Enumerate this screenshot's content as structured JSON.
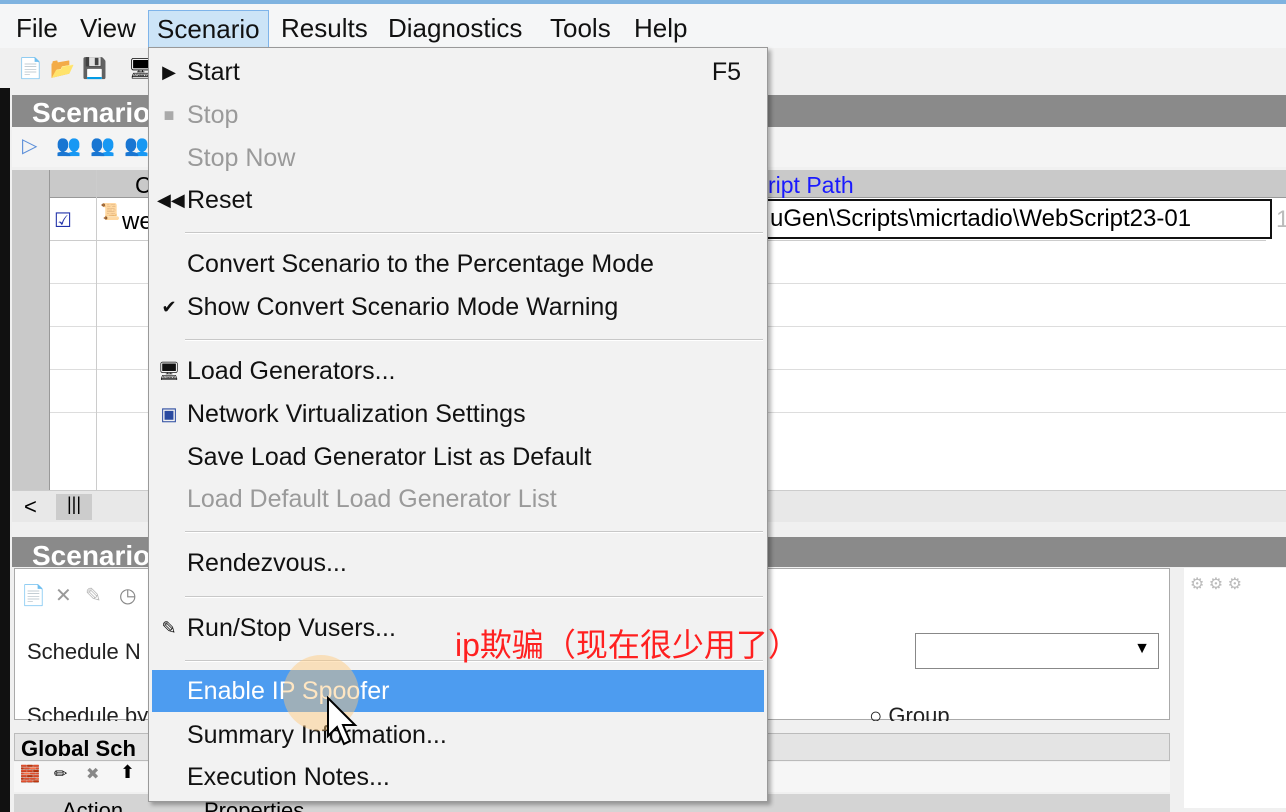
{
  "menubar": {
    "items": [
      "File",
      "View",
      "Scenario",
      "Results",
      "Diagnostics",
      "Tools",
      "Help"
    ],
    "active": "Scenario"
  },
  "scenario_groups": {
    "title": "Scenario",
    "grid": {
      "header_partial": "C",
      "script_path_header": "ript Path",
      "row": {
        "checked": true,
        "name_partial": "we",
        "script_path": "uGen\\Scripts\\micrtadio\\WebScript23-01",
        "next_partial": "1"
      }
    }
  },
  "scenario_schedule": {
    "title": "Scenario",
    "schedule_name_label": "Schedule N",
    "schedule_by_label": "Schedule by",
    "group_option": "Group",
    "global_schedule_title": "Global Sch",
    "action_header": "Action",
    "properties_header": "Properties"
  },
  "scenario_menu": {
    "items": [
      {
        "label": "Start",
        "shortcut": "F5",
        "icon": "play-icon",
        "disabled": false
      },
      {
        "label": "Stop",
        "icon": "stop-icon",
        "disabled": true
      },
      {
        "label": "Stop Now",
        "disabled": true
      },
      {
        "label": "Reset",
        "icon": "rewind-icon",
        "disabled": false
      },
      {
        "label": "Convert Scenario to the Percentage Mode",
        "disabled": false
      },
      {
        "label": "Show Convert Scenario Mode Warning",
        "checked": true,
        "disabled": false
      },
      {
        "label": "Load Generators...",
        "icon": "load-generator-icon",
        "disabled": false
      },
      {
        "label": "Network Virtualization Settings",
        "icon": "network-icon",
        "disabled": false
      },
      {
        "label": "Save Load Generator List as Default",
        "disabled": false
      },
      {
        "label": "Load Default Load Generator List",
        "disabled": true
      },
      {
        "label": "Rendezvous...",
        "disabled": false
      },
      {
        "label": "Run/Stop Vusers...",
        "icon": "vusers-icon",
        "disabled": false
      },
      {
        "label": "Enable IP Spoofer",
        "highlighted": true,
        "disabled": false
      },
      {
        "label": "Summary Information...",
        "disabled": false
      },
      {
        "label": "Execution Notes...",
        "disabled": false
      }
    ]
  },
  "annotation": "ip欺骗（现在很少用了）",
  "colors": {
    "highlight": "#4d9cf0",
    "annotation": "#ff2020",
    "panel_title": "#8a8a8a"
  }
}
